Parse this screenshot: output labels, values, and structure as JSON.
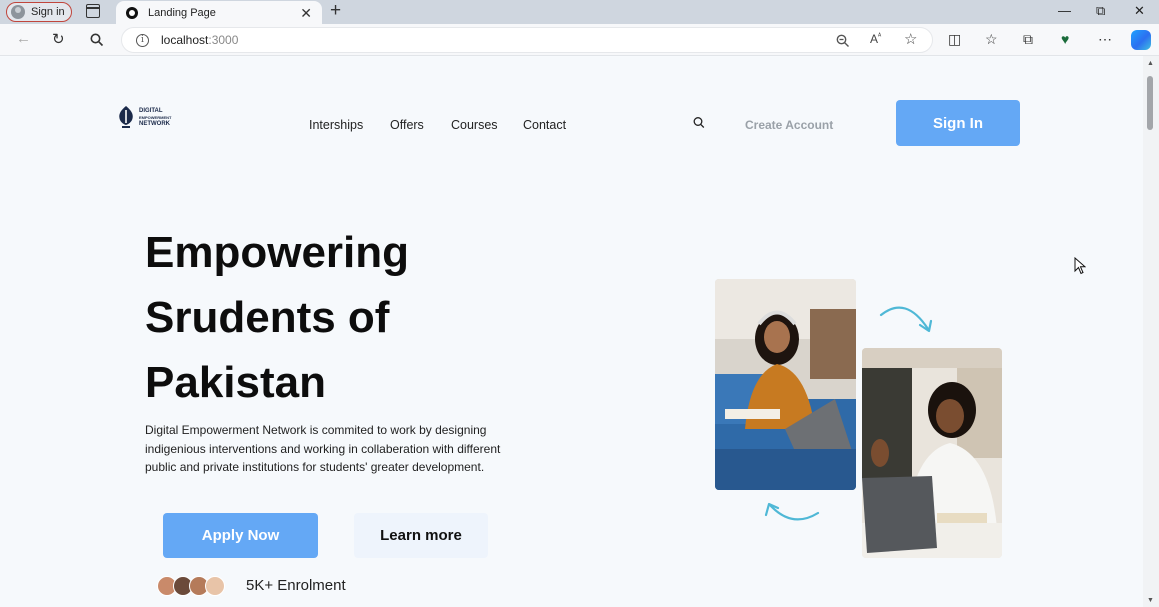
{
  "browser": {
    "profile_label": "Sign in",
    "tab_title": "Landing Page",
    "tab_close": "✕",
    "new_tab": "+",
    "url_host": "localhost",
    "url_port": ":3000",
    "window_controls": [
      "—",
      "⧉",
      "✕"
    ],
    "icons": [
      "back-icon",
      "refresh-icon",
      "search-icon",
      "info-icon",
      "zoom-icon",
      "read-aloud-icon",
      "favorite-star-icon",
      "split-screen-icon",
      "favorites-icon",
      "collections-icon",
      "browser-essentials-icon",
      "more-icon",
      "copilot-icon"
    ]
  },
  "logo": {
    "lines": [
      "DIGITAL",
      "EMPOWERMENT",
      "NETWORK"
    ]
  },
  "nav": {
    "items": [
      "Interships",
      "Offers",
      "Courses",
      "Contact"
    ],
    "create_account": "Create Account",
    "sign_in": "Sign In"
  },
  "hero": {
    "title_lines": [
      "Empowering",
      "Srudents of",
      "Pakistan"
    ],
    "description": "Digital Empowerment Network is commited to work by designing indigenious interventions and working in collaberation with different public and private institutions for students' greater development.",
    "apply_label": "Apply Now",
    "learn_label": "Learn more",
    "enrolment": "5K+ Enrolment"
  },
  "colors": {
    "primary": "#64a8f5",
    "learn_bg": "#eef4fc",
    "page_bg": "#f6f9fc",
    "arrow": "#4fb8d6"
  }
}
